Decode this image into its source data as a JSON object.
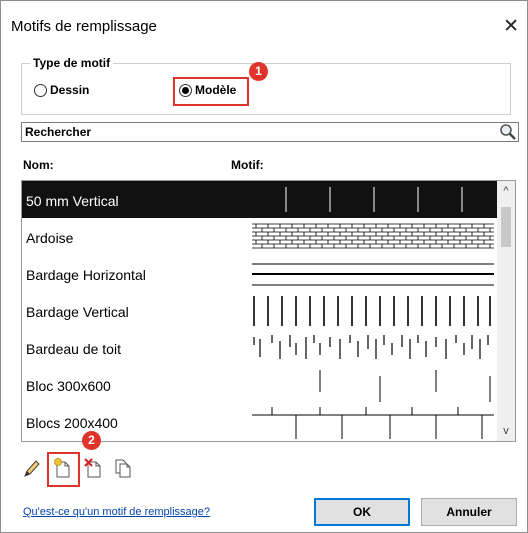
{
  "dialog": {
    "title": "Motifs de remplissage",
    "close_icon": "close-icon"
  },
  "motif_type": {
    "legend": "Type de motif",
    "options": [
      {
        "label": "Dessin",
        "checked": false
      },
      {
        "label": "Modèle",
        "checked": true
      }
    ]
  },
  "callouts": [
    "1",
    "2"
  ],
  "search": {
    "placeholder": "Rechercher",
    "icon": "search-icon"
  },
  "columns": {
    "name": "Nom:",
    "pattern": "Motif:"
  },
  "patterns": [
    {
      "name": "50 mm Vertical",
      "selected": true,
      "icon": "vertical-lines-pattern"
    },
    {
      "name": "Ardoise",
      "selected": false,
      "icon": "slate-pattern"
    },
    {
      "name": "Bardage Horizontal",
      "selected": false,
      "icon": "horizontal-siding-pattern"
    },
    {
      "name": "Bardage Vertical",
      "selected": false,
      "icon": "vertical-siding-pattern"
    },
    {
      "name": "Bardeau de toit",
      "selected": false,
      "icon": "roof-shingle-pattern"
    },
    {
      "name": "Bloc 300x600",
      "selected": false,
      "icon": "block-300x600-pattern"
    },
    {
      "name": "Blocs 200x400",
      "selected": false,
      "icon": "blocks-200x400-pattern"
    }
  ],
  "toolbar": [
    "edit-icon",
    "new-pattern-icon",
    "delete-pattern-icon",
    "duplicate-pattern-icon"
  ],
  "footer": {
    "help_link": "Qu'est-ce qu'un motif de remplissage?",
    "ok_label": "OK",
    "cancel_label": "Annuler"
  },
  "colors": {
    "accent": "#e0342b",
    "selection": "#111111",
    "link": "#0645ad"
  }
}
